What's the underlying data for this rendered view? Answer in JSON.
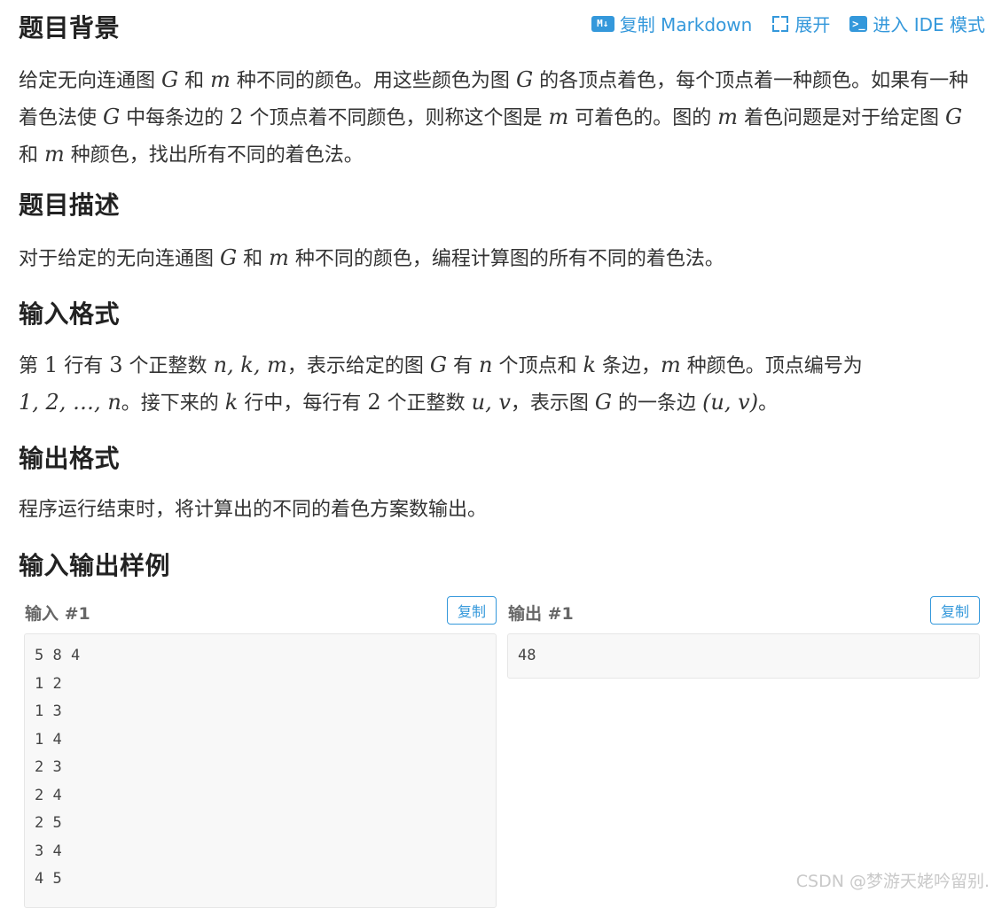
{
  "toolbar": {
    "copy_markdown": "复制 Markdown",
    "expand": "展开",
    "ide": "进入 IDE 模式",
    "md_icon": "M↓",
    "ide_icon": ">_"
  },
  "sections": {
    "background": {
      "title": "题目背景",
      "p1_a": "给定无向连通图 ",
      "G": "G",
      "m": "m",
      "p1_b": " 和 ",
      "p1_c": " 种不同的颜色。用这些颜色为图 ",
      "p1_d": " 的各顶点着色，每个顶点着一种颜色。如果有一种着色法使 ",
      "p1_e": " 中每条边的 ",
      "two": "2",
      "p1_f": " 个顶点着不同颜色，则称这个图是 ",
      "p1_g": " 可着色的。图的 ",
      "p1_h": " 着色问题是对于给定图 ",
      "p1_i": " 和 ",
      "p1_j": " 种颜色，找出所有不同的着色法。"
    },
    "description": {
      "title": "题目描述",
      "a": "对于给定的无向连通图 ",
      "b": " 和 ",
      "c": " 种不同的颜色，编程计算图的所有不同的着色法。"
    },
    "input_format": {
      "title": "输入格式",
      "a": "第 ",
      "one": "1",
      "b": " 行有 ",
      "three": "3",
      "c": " 个正整数 ",
      "nkm": "n, k, m",
      "d": "，表示给定的图 ",
      "e": " 有 ",
      "n": "n",
      "f": " 个顶点和 ",
      "k": "k",
      "g": " 条边，",
      "h": " 种颜色。顶点编号为 ",
      "range": "1, 2, …, n",
      "i": "。接下来的 ",
      "j": " 行中，每行有 ",
      "l": " 个正整数 ",
      "uv": "u, v",
      "o": "，表示图 ",
      "p": " 的一条边 ",
      "edge": "(u, v)",
      "q": "。"
    },
    "output_format": {
      "title": "输出格式",
      "text": "程序运行结束时，将计算出的不同的着色方案数输出。"
    },
    "samples": {
      "title": "输入输出样例",
      "input_title": "输入 #1",
      "output_title": "输出 #1",
      "copy": "复制",
      "input_lines": [
        "5 8 4",
        "1 2",
        "1 3",
        "1 4",
        "2 3",
        "2 4",
        "2 5",
        "3 4",
        "4 5"
      ],
      "output_lines": [
        "48"
      ]
    }
  },
  "watermark": "CSDN @梦游天姥吟留别.",
  "colors": {
    "accent": "#3498db",
    "text": "#333333",
    "code_bg": "#f8f8f8"
  }
}
